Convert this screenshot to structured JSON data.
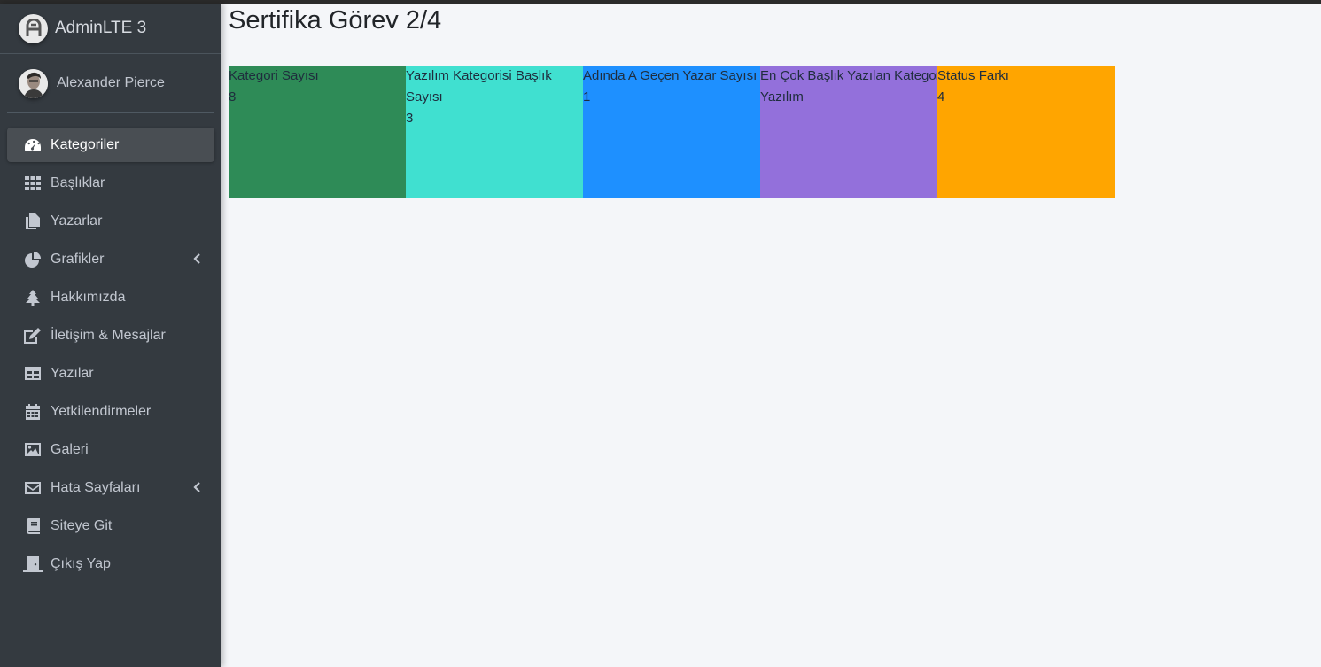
{
  "brand": {
    "name": "AdminLTE 3"
  },
  "user": {
    "name": "Alexander Pierce"
  },
  "sidebar": {
    "items": [
      {
        "label": "Kategoriler",
        "icon": "dashboard-icon",
        "active": true
      },
      {
        "label": "Başlıklar",
        "icon": "grid-icon"
      },
      {
        "label": "Yazarlar",
        "icon": "copy-icon"
      },
      {
        "label": "Grafikler",
        "icon": "pie-chart-icon",
        "has_children": true
      },
      {
        "label": "Hakkımızda",
        "icon": "tree-icon"
      },
      {
        "label": "İletişim & Mesajlar",
        "icon": "edit-icon"
      },
      {
        "label": "Yazılar",
        "icon": "table-icon"
      },
      {
        "label": "Yetkilendirmeler",
        "icon": "calendar-icon"
      },
      {
        "label": "Galeri",
        "icon": "image-icon"
      },
      {
        "label": "Hata Sayfaları",
        "icon": "envelope-icon",
        "has_children": true
      },
      {
        "label": "Siteye Git",
        "icon": "book-icon"
      },
      {
        "label": "Çıkış Yap",
        "icon": "door-icon"
      }
    ]
  },
  "page": {
    "title": "Sertifika Görev 2/4"
  },
  "cards": [
    {
      "label": "Kategori Sayısı",
      "value": "8",
      "color": "#2e8b57"
    },
    {
      "label": "Yazılım Kategorisi Başlık Sayısı",
      "value": "3",
      "color": "#40e0d0"
    },
    {
      "label": "Adında A Geçen Yazar Sayısı",
      "value": "1",
      "color": "#1e90ff"
    },
    {
      "label": "En Çok Başlık Yazılan Kategori",
      "value": "Yazılım",
      "color": "#9370db"
    },
    {
      "label": "Status Farkı",
      "value": "4",
      "color": "#ffa500"
    }
  ]
}
